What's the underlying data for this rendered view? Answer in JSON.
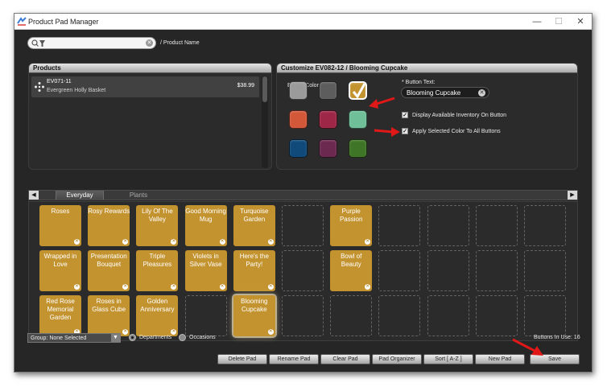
{
  "window": {
    "title": "Product Pad Manager",
    "minimize": "—",
    "maximize": "☐",
    "close": "✕"
  },
  "search": {
    "value": "",
    "placeholder": "",
    "field_label": "/ Product Name"
  },
  "products_panel": {
    "title": "Products",
    "items": [
      {
        "code": "EV071-11",
        "name": "Evergreen Holly Basket",
        "price": "$38.99"
      }
    ]
  },
  "customize_panel": {
    "title": "Customize EV082-12 / Blooming Cupcake",
    "button_color_label": "Button Color:",
    "colors": [
      "#9b9b9b",
      "#5d5d5d",
      "#c3932f",
      "#d3583a",
      "#9e2747",
      "#6fbf98",
      "#0f4a7a",
      "#6b2950",
      "#3f7526"
    ],
    "selected_color": "#c3932f",
    "button_text_label": "* Button Text:",
    "button_text_value": "Blooming Cupcake",
    "display_inventory": {
      "label": "Display Available Inventory On Button",
      "checked": true
    },
    "apply_color": {
      "label": "Apply Selected Color To All Buttons",
      "checked": true
    }
  },
  "tabs": [
    {
      "label": "Everyday",
      "active": true
    },
    {
      "label": "Plants",
      "active": false
    }
  ],
  "pad_buttons": [
    {
      "label": "Roses"
    },
    {
      "label": "Rosy Rewards"
    },
    {
      "label": "Lily Of The Valley"
    },
    {
      "label": "Good Morning Mug"
    },
    {
      "label": "Turquoise Garden"
    },
    {
      "label": "Purple Passion"
    },
    {
      "label": "Wrapped in Love"
    },
    {
      "label": "Presentation Bouquet"
    },
    {
      "label": "Triple Pleasures"
    },
    {
      "label": "Violets in Silver Vase"
    },
    {
      "label": "Here's the Party!"
    },
    {
      "label": "Bowl of Beauty"
    },
    {
      "label": "Red Rose Memorial Garden"
    },
    {
      "label": "Roses in Glass Cube"
    },
    {
      "label": "Golden Anniversary"
    },
    {
      "label": "Blooming Cupcake"
    }
  ],
  "footer": {
    "group_select": "Group: None Selected",
    "radio_departments": "Departments",
    "radio_occasions": "Occasions",
    "buttons_in_use": "Buttons In Use: 16",
    "actions": [
      "Delete Pad",
      "Rename Pad",
      "Clear Pad",
      "Pad Organizer",
      "Sort [ A-Z ]",
      "New Pad",
      "Save"
    ]
  },
  "accent_color": "#e01818"
}
